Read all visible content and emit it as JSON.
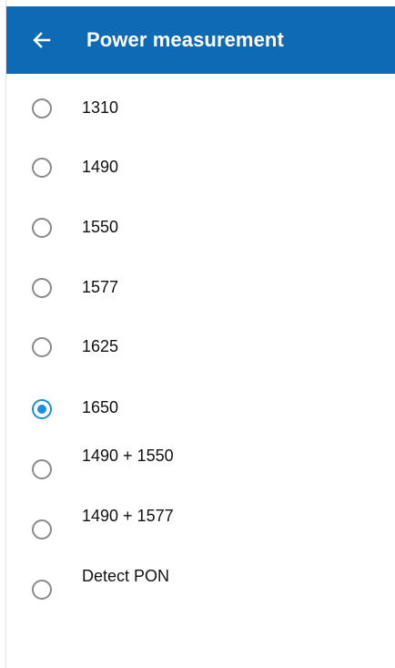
{
  "header": {
    "title": "Power measurement",
    "back_icon": "arrow-left-icon",
    "background_color": "#0e6ab4"
  },
  "options": [
    {
      "label": "1310",
      "selected": false
    },
    {
      "label": "1490",
      "selected": false
    },
    {
      "label": "1550",
      "selected": false
    },
    {
      "label": "1577",
      "selected": false
    },
    {
      "label": "1625",
      "selected": false
    },
    {
      "label": "1650",
      "selected": true
    },
    {
      "label": "1490 + 1550",
      "selected": false
    },
    {
      "label": "1490 + 1577",
      "selected": false
    },
    {
      "label": "Detect PON",
      "selected": false
    }
  ],
  "colors": {
    "accent": "#1a8ee6",
    "radio_unselected": "#8a8a8a",
    "text": "#111111"
  }
}
